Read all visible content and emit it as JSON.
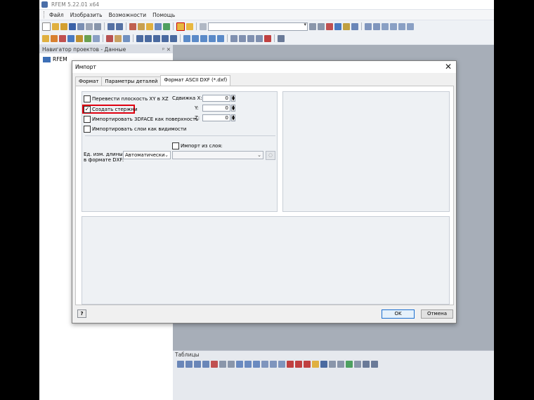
{
  "app": {
    "title": "RFEM 5.22.01 x64",
    "menu": [
      "Файл",
      "Изобразить",
      "Возможности",
      "Помощь"
    ]
  },
  "navigator": {
    "title": "Навигатор проектов - Данные",
    "controls": "ᵖ ✕",
    "root_item": "RFEM"
  },
  "tables_panel": {
    "title": "Таблицы"
  },
  "dialog": {
    "title": "Импорт",
    "close": "✕",
    "tabs": [
      "Формат",
      "Параметры деталей",
      "Формат ASCII DXF (*.dxf)"
    ],
    "options": {
      "xy_to_xz": {
        "label": "Перевести плоскость XY в XZ",
        "checked": false
      },
      "create_members": {
        "label": "Создать стержни",
        "checked": true
      },
      "import_3dface": {
        "label": "Импортировать 3DFACE как поверхность",
        "checked": false
      },
      "import_layers": {
        "label": "Импортировать слои как видимости",
        "checked": false
      }
    },
    "offset": {
      "x_label": "Сдвижка X:",
      "y_label": "Y:",
      "z_label": "Z:",
      "x_value": "0",
      "y_value": "0",
      "z_value": "0"
    },
    "import_from_layer": {
      "label": "Импорт из слоя:",
      "checked": false,
      "value": ""
    },
    "units": {
      "label_line1": "Ед. изм. длины",
      "label_line2": "в формате DXF:",
      "value": "Автоматически"
    },
    "buttons": {
      "help": "?",
      "ok": "OK",
      "cancel": "Отмена"
    }
  },
  "colors": {
    "highlight": "#e00010",
    "ok_border": "#1a6fd1",
    "workarea": "#a7aeb8"
  }
}
